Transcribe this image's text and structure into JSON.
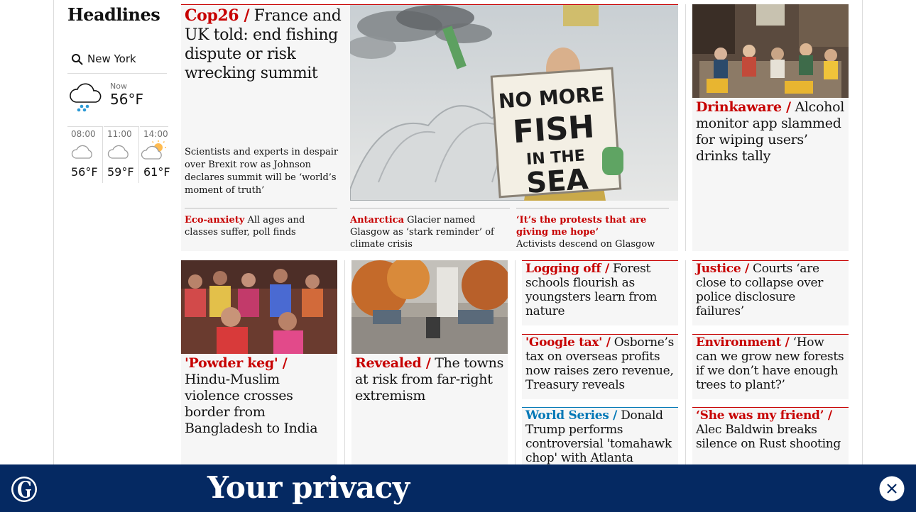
{
  "sidebar": {
    "section_title": "Headlines",
    "location": "New York",
    "now_label": "Now",
    "now_temp": "56°F",
    "forecast": [
      {
        "time": "08:00",
        "temp": "56°F",
        "icon": "cloud-icon"
      },
      {
        "time": "11:00",
        "temp": "59°F",
        "icon": "cloud-icon"
      },
      {
        "time": "14:00",
        "temp": "61°F",
        "icon": "sun-cloud-icon"
      }
    ]
  },
  "lead": {
    "kicker": "Cop26 /",
    "headline": "France and UK told: end fishing dispute or risk wrecking summit",
    "standfirst": "Scientists and experts in despair over Brexit row as Johnson declares summit will be ‘world’s moment of truth’",
    "image_sign_text": "NO MORE FISH IN THE SEA",
    "sublinks": [
      {
        "kicker": "Eco-anxiety",
        "text": "All ages and classes suffer, poll finds"
      },
      {
        "kicker": "Antarctica",
        "text": "Glacier named Glasgow as ‘stark reminder’ of climate crisis"
      },
      {
        "kicker": "‘It’s the protests that are giving me hope’",
        "text": "Activists descend on Glasgow"
      }
    ]
  },
  "right_top": {
    "kicker": "Drinkaware /",
    "headline": "Alcohol monitor app slammed for wiping users’ drinks tally"
  },
  "row2": {
    "card1": {
      "kicker": "'Powder keg' /",
      "headline": "Hindu-Muslim violence crosses border from Bangladesh to India"
    },
    "card2": {
      "kicker": "Revealed /",
      "headline": "The towns at risk from far-right extremism"
    },
    "list_left": [
      {
        "kicker": "Logging off /",
        "headline": "Forest schools flourish as youngsters learn from nature",
        "color": "red"
      },
      {
        "kicker": "'Google tax' /",
        "headline": "Osborne’s tax on overseas profits now raises zero revenue, Treasury reveals",
        "color": "red"
      },
      {
        "kicker": "World Series /",
        "headline": "Donald Trump performs controversial 'tomahawk chop' with Atlanta Braves",
        "color": "blue"
      }
    ],
    "list_right": [
      {
        "kicker": "Justice /",
        "headline": "Courts ‘are close to collapse over police disclosure failures’",
        "color": "red"
      },
      {
        "kicker": "Environment /",
        "headline": "‘How can we grow new forests if we don’t have enough trees to plant?’",
        "color": "red"
      },
      {
        "kicker": "‘She was my friend’ /",
        "headline": "Alec Baldwin breaks silence on Rust shooting",
        "color": "red"
      }
    ]
  },
  "privacy_banner": {
    "title": "Your privacy",
    "bg_color": "#052962",
    "close_icon": "close-icon"
  },
  "colors": {
    "news_red": "#c70000",
    "sport_blue": "#0077b6",
    "card_bg": "#f6f6f6"
  }
}
